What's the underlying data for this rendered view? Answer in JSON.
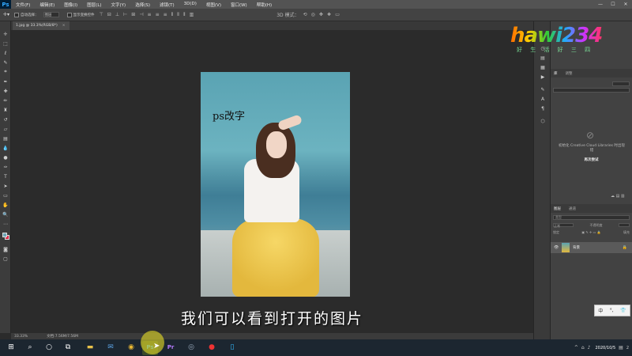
{
  "menubar": {
    "logo": "Ps",
    "items": [
      "文件(F)",
      "编辑(E)",
      "图像(I)",
      "图层(L)",
      "文字(Y)",
      "选择(S)",
      "滤镜(T)",
      "3D(D)",
      "视图(V)",
      "窗口(W)",
      "帮助(H)"
    ],
    "controls": [
      "—",
      "☐",
      "✕"
    ]
  },
  "options": {
    "auto_select_label": "自动选择：",
    "auto_select_value": "图层",
    "transform_label": "显示变换控件"
  },
  "document": {
    "tab_label": "1.jpg @ 33.3%(RGB/8*)",
    "close": "×"
  },
  "canvas": {
    "photo_text": "ps改字"
  },
  "subtitle": "我们可以看到打开的图片",
  "status": {
    "zoom": "33.33%",
    "doc_size": "文档:7.56M/7.56M"
  },
  "logo": {
    "text": "hawi234",
    "sub": "好 生 活 好 三 四"
  },
  "panels": {
    "library_tabs": [
      "库",
      "调整"
    ],
    "library_message": "初始化 Creative Cloud Libraries 时出现错",
    "library_link": "再次尝试",
    "layers_tabs": [
      "图层",
      "通道"
    ],
    "layer_filter_placeholder": "类型",
    "mode": "正常",
    "opacity_label": "不透明度",
    "lock_label": "锁定",
    "fill_label": "填充",
    "layer_name": "背景"
  },
  "ime": [
    "中",
    "°,",
    "👕"
  ],
  "taskbar": {
    "time": "",
    "date": "2020/10/5",
    "badge": "2"
  }
}
